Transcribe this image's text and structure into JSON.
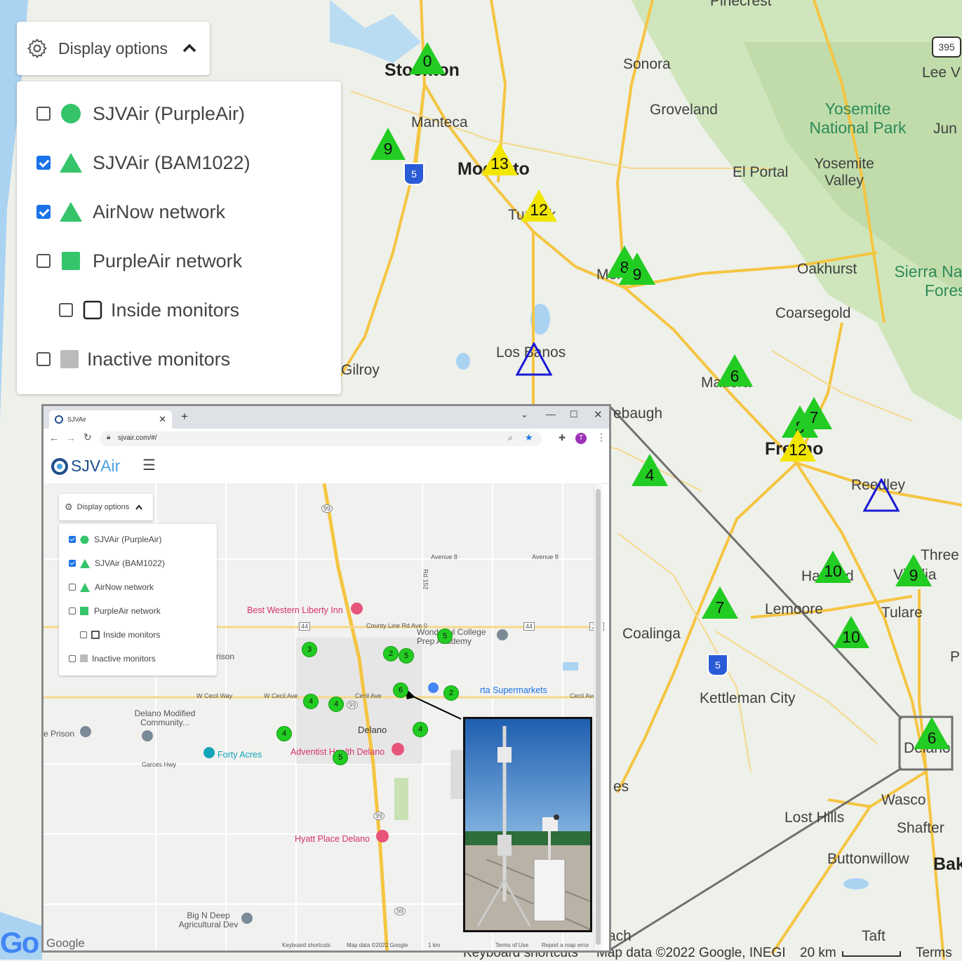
{
  "display_options": {
    "button_label": "Display options",
    "options": [
      {
        "label": "SJVAir (PurpleAir)",
        "checked": false,
        "symbol": "circle",
        "color": "#35c46a"
      },
      {
        "label": "SJVAir (BAM1022)",
        "checked": true,
        "symbol": "triangle",
        "color": "#35c46a"
      },
      {
        "label": "AirNow network",
        "checked": true,
        "symbol": "triangle",
        "color": "#35c46a"
      },
      {
        "label": "PurpleAir network",
        "checked": false,
        "symbol": "square",
        "color": "#35c46a"
      },
      {
        "label": "Inside monitors",
        "checked": false,
        "symbol": "square-outline",
        "color": "#222222"
      },
      {
        "label": "Inactive monitors",
        "checked": false,
        "symbol": "square",
        "color": "#bbbbbb"
      }
    ]
  },
  "map": {
    "places": {
      "pinecrest": "Pinecrest",
      "stockton": "Stockton",
      "sonora": "Sonora",
      "manteca": "Manteca",
      "groveland": "Groveland",
      "modesto": "Modesto",
      "el_portal": "El Portal",
      "yosemite_valley": "Yosemite Valley",
      "yosemite_np": "Yosemite National Park",
      "jun": "Jun",
      "lee_v": "Lee V",
      "turlock": "Turlock",
      "merced": "Merced",
      "oakhurst": "Oakhurst",
      "sierra_nf": "Sierra Nati Forest",
      "coarsegold": "Coarsegold",
      "los_banos": "Los Banos",
      "gilroy": "Gilroy",
      "madera": "Madera",
      "chowchilla": "ebaugh",
      "fresno": "Fresno",
      "reedley": "Reedley",
      "hanford": "Hanford",
      "visalia": "Visalia",
      "three": "Three",
      "lemoore": "Lemoore",
      "tulare": "Tulare",
      "coalinga": "Coalinga",
      "kettleman": "Kettleman City",
      "delano": "Delano",
      "wasco": "Wasco",
      "lost_hills": "Lost Hills",
      "shafter": "Shafter",
      "buttonwillow": "Buttonwillow",
      "bak": "Bak",
      "taft": "Taft",
      "ach": "ach",
      "es": "es",
      "p": "P"
    },
    "highway_shields": {
      "i5": "5",
      "us395": "395"
    },
    "markers": [
      {
        "id": "stockton",
        "value": "0",
        "color": "#22cc22"
      },
      {
        "id": "manteca",
        "value": "9",
        "color": "#22cc22"
      },
      {
        "id": "modesto",
        "value": "13",
        "color": "#f2e600"
      },
      {
        "id": "turlock",
        "value": "12",
        "color": "#f2e600"
      },
      {
        "id": "merced-a",
        "value": "8",
        "color": "#22cc22"
      },
      {
        "id": "merced-b",
        "value": "9",
        "color": "#22cc22"
      },
      {
        "id": "los-banos",
        "value": "",
        "color": "#1a1ad6"
      },
      {
        "id": "madera",
        "value": "6",
        "color": "#22cc22"
      },
      {
        "id": "fresno-a",
        "value": "8",
        "color": "#22cc22"
      },
      {
        "id": "fresno-b",
        "value": "7",
        "color": "#22cc22"
      },
      {
        "id": "fresno-c",
        "value": "12",
        "color": "#f2e600"
      },
      {
        "id": "kerman",
        "value": "4",
        "color": "#22cc22"
      },
      {
        "id": "reedley",
        "value": "",
        "color": "#1a1ad6"
      },
      {
        "id": "hanford",
        "value": "10",
        "color": "#22cc22"
      },
      {
        "id": "visalia",
        "value": "9",
        "color": "#22cc22"
      },
      {
        "id": "lemoore",
        "value": "7",
        "color": "#22cc22"
      },
      {
        "id": "tulare",
        "value": "10",
        "color": "#22cc22"
      },
      {
        "id": "delano",
        "value": "6",
        "color": "#22cc22"
      }
    ],
    "footer": {
      "keyboard": "Keyboard shortcuts",
      "map_data": "Map data ©2022 Google, INEGI",
      "scale": "20 km",
      "terms": "Terms"
    }
  },
  "inset": {
    "tab_title": "SJVAir",
    "new_tab": "+",
    "url": "sjvair.com/#/",
    "avatar": "T",
    "app_name_a": "SJV",
    "app_name_b": "Air",
    "display_options": {
      "button_label": "Display options",
      "options": [
        {
          "label": "SJVAir (PurpleAir)",
          "checked": true,
          "symbol": "circle"
        },
        {
          "label": "SJVAir (BAM1022)",
          "checked": true,
          "symbol": "triangle"
        },
        {
          "label": "AirNow network",
          "checked": false,
          "symbol": "triangle"
        },
        {
          "label": "PurpleAir network",
          "checked": false,
          "symbol": "square"
        },
        {
          "label": "Inside monitors",
          "checked": false,
          "symbol": "square-outline"
        },
        {
          "label": "Inactive monitors",
          "checked": false,
          "symbol": "square-gray"
        }
      ]
    },
    "map_labels": {
      "avenue8a": "Avenue 8",
      "avenue8b": "Avenue 8",
      "rd152": "Rd 152",
      "best_western": "Best Western Liberty Inn",
      "county_line": "County Line Rd Ave 0",
      "wonderful": "Wonderful College Prep Academy",
      "rison": "rison",
      "w_cecil_way": "W Cecil Way",
      "w_cecil_ave": "W Cecil Ave",
      "cecil_ave": "Cecil Ave",
      "cecil_ave2": "Cecil Ave",
      "valle": "Valle",
      "supermarkets": "rta Supermarkets",
      "delano_modified": "Delano Modified Community...",
      "prison": "e Prison",
      "delano": "Delano",
      "forty_acres": "Forty Acres",
      "adventist": "Adventist Health Delano",
      "garces": "Garces Hwy",
      "hyatt": "Hyatt Place Delano",
      "big_n_deep": "Big N Deep Agricultural Dev",
      "google": "Google",
      "footer_kb": "Keyboard shortcuts",
      "footer_md": "Map data ©2022 Google",
      "footer_scale": "1 km",
      "footer_terms": "Terms of Use",
      "footer_report": "Report a map error",
      "rte99a": "99",
      "rte99b": "99",
      "rte99c": "99",
      "rte99d": "99",
      "rte44a": "44",
      "rte44b": "44",
      "j44": "J44"
    },
    "dots": [
      "3",
      "2",
      "5",
      "5",
      "4",
      "4",
      "6",
      "2",
      "4",
      "4",
      "5"
    ]
  },
  "colors": {
    "marker_green": "#22cc22",
    "marker_yellow": "#f2e600",
    "marker_blue_outline": "#1a1ad6",
    "checkbox_blue": "#1a73e8",
    "road_yellow": "#f5c542",
    "water": "#aad3f2",
    "park_green": "#c8e2b4"
  }
}
